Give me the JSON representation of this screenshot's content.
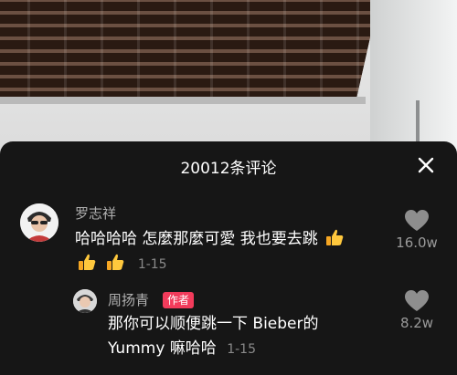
{
  "panel": {
    "title": "20012条评论",
    "close_icon": "close-icon"
  },
  "comments": [
    {
      "username": "罗志祥",
      "text": "哈哈哈哈 怎麼那麼可愛 我也要去跳",
      "time": "1-15",
      "like_count": "16.0w",
      "emojis": [
        "thumbs-up-emoji",
        "thumbs-up-emoji",
        "thumbs-up-emoji"
      ]
    },
    {
      "username": "周扬青",
      "badge": "作者",
      "text_line1": "那你可以顺便跳一下 Bieber的",
      "text_line2": "Yummy 嘛哈哈",
      "time": "1-15",
      "like_count": "8.2w"
    }
  ],
  "colors": {
    "badge": "#f23b5b",
    "panel_bg": "#161616"
  }
}
